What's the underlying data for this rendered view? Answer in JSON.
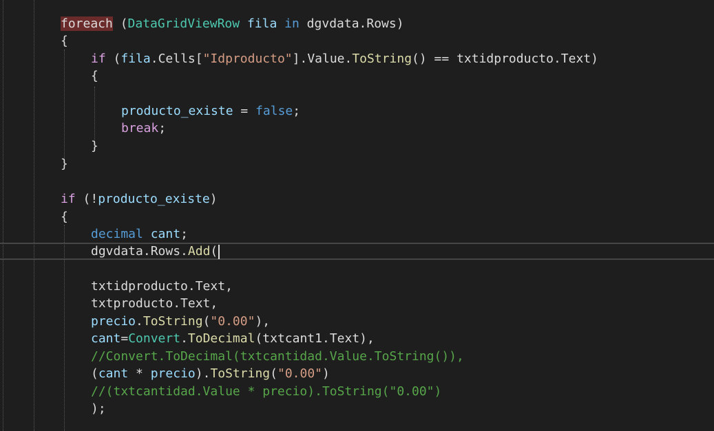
{
  "editor": {
    "lines": [
      {
        "t": [
          [
            "hl-kw",
            "foreach"
          ],
          [
            "plain",
            " ("
          ],
          [
            "type",
            "DataGridViewRow"
          ],
          [
            "plain",
            " "
          ],
          [
            "var",
            "fila"
          ],
          [
            "plain",
            " "
          ],
          [
            "kw",
            "in"
          ],
          [
            "plain",
            " dgvdata.Rows)"
          ]
        ]
      },
      {
        "t": [
          [
            "plain",
            "{"
          ]
        ]
      },
      {
        "t": [
          [
            "kw-ctl",
            "if"
          ],
          [
            "plain",
            " ("
          ],
          [
            "var",
            "fila"
          ],
          [
            "plain",
            ".Cells["
          ],
          [
            "str",
            "\"Idproducto\""
          ],
          [
            "plain",
            "].Value."
          ],
          [
            "method",
            "ToString"
          ],
          [
            "plain",
            "() == txtidproducto.Text)"
          ]
        ]
      },
      {
        "t": [
          [
            "plain",
            "{"
          ]
        ]
      },
      {
        "t": []
      },
      {
        "t": [
          [
            "var",
            "producto_existe"
          ],
          [
            "plain",
            " = "
          ],
          [
            "kw",
            "false"
          ],
          [
            "plain",
            ";"
          ]
        ]
      },
      {
        "t": [
          [
            "kw-ctl",
            "break"
          ],
          [
            "plain",
            ";"
          ]
        ]
      },
      {
        "t": [
          [
            "plain",
            "}"
          ]
        ]
      },
      {
        "t": [
          [
            "plain",
            "}"
          ]
        ]
      },
      {
        "t": []
      },
      {
        "t": [
          [
            "kw-ctl",
            "if"
          ],
          [
            "plain",
            " (!"
          ],
          [
            "var",
            "producto_existe"
          ],
          [
            "plain",
            ")"
          ]
        ]
      },
      {
        "t": [
          [
            "plain",
            "{"
          ]
        ]
      },
      {
        "t": [
          [
            "kw",
            "decimal"
          ],
          [
            "plain",
            " "
          ],
          [
            "var",
            "cant"
          ],
          [
            "plain",
            ";"
          ]
        ]
      },
      {
        "t": [
          [
            "plain",
            "dgvdata.Rows."
          ],
          [
            "method",
            "Add"
          ],
          [
            "plain",
            "("
          ]
        ]
      },
      {
        "t": []
      },
      {
        "t": [
          [
            "plain",
            "txtidproducto.Text,"
          ]
        ]
      },
      {
        "t": [
          [
            "plain",
            "txtproducto.Text,"
          ]
        ]
      },
      {
        "t": [
          [
            "var",
            "precio"
          ],
          [
            "plain",
            "."
          ],
          [
            "method",
            "ToString"
          ],
          [
            "plain",
            "("
          ],
          [
            "str",
            "\"0.00\""
          ],
          [
            "plain",
            "),"
          ]
        ]
      },
      {
        "t": [
          [
            "var",
            "cant"
          ],
          [
            "plain",
            "="
          ],
          [
            "type",
            "Convert"
          ],
          [
            "plain",
            "."
          ],
          [
            "method",
            "ToDecimal"
          ],
          [
            "plain",
            "(txtcant1.Text),"
          ]
        ]
      },
      {
        "t": [
          [
            "comment",
            "//Convert.ToDecimal(txtcantidad.Value.ToString()),"
          ]
        ]
      },
      {
        "t": [
          [
            "plain",
            "("
          ],
          [
            "var",
            "cant"
          ],
          [
            "plain",
            " * "
          ],
          [
            "var",
            "precio"
          ],
          [
            "plain",
            ")."
          ],
          [
            "method",
            "ToString"
          ],
          [
            "plain",
            "("
          ],
          [
            "str",
            "\"0.00\""
          ],
          [
            "plain",
            ")"
          ]
        ]
      },
      {
        "t": [
          [
            "comment",
            "//(txtcantidad.Value * precio).ToString(\"0.00\")"
          ]
        ]
      },
      {
        "t": [
          [
            "plain",
            ");"
          ]
        ]
      }
    ]
  }
}
